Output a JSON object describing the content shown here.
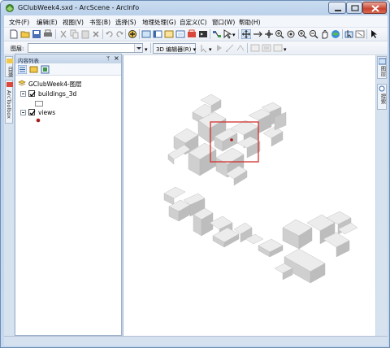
{
  "window": {
    "title": "GClubWeek4.sxd - ArcScene - ArcInfo"
  },
  "menubar": {
    "items": [
      {
        "label": "文件(F)"
      },
      {
        "label": "编辑(E)"
      },
      {
        "label": "视图(V)"
      },
      {
        "label": "书签(B)"
      },
      {
        "label": "选择(S)"
      },
      {
        "label": "地理处理(G)"
      },
      {
        "label": "自定义(C)"
      },
      {
        "label": "窗口(W)"
      },
      {
        "label": "帮助(H)"
      }
    ]
  },
  "toolbar3": {
    "layer_label": "图层:",
    "layer_value": "",
    "editor_label": "3D 编辑器(R)"
  },
  "side_tabs": {
    "left": [
      "目录",
      "ArcToolbox"
    ],
    "right": [
      "图层",
      "搜索"
    ]
  },
  "toc": {
    "title": "内容列表",
    "pin_icon": "pin-icon",
    "close_icon": "close-icon",
    "root": "GClubWeek4-图层",
    "layers": [
      {
        "name": "buildings_3d",
        "checked": true
      },
      {
        "name": "views",
        "checked": true
      }
    ]
  },
  "colors": {
    "selection_box": "#d0312d",
    "view_point": "#a61c1c",
    "building_top": "#ececec",
    "building_side": "#cfcfcf",
    "building_shadow": "#b8b8b8"
  }
}
